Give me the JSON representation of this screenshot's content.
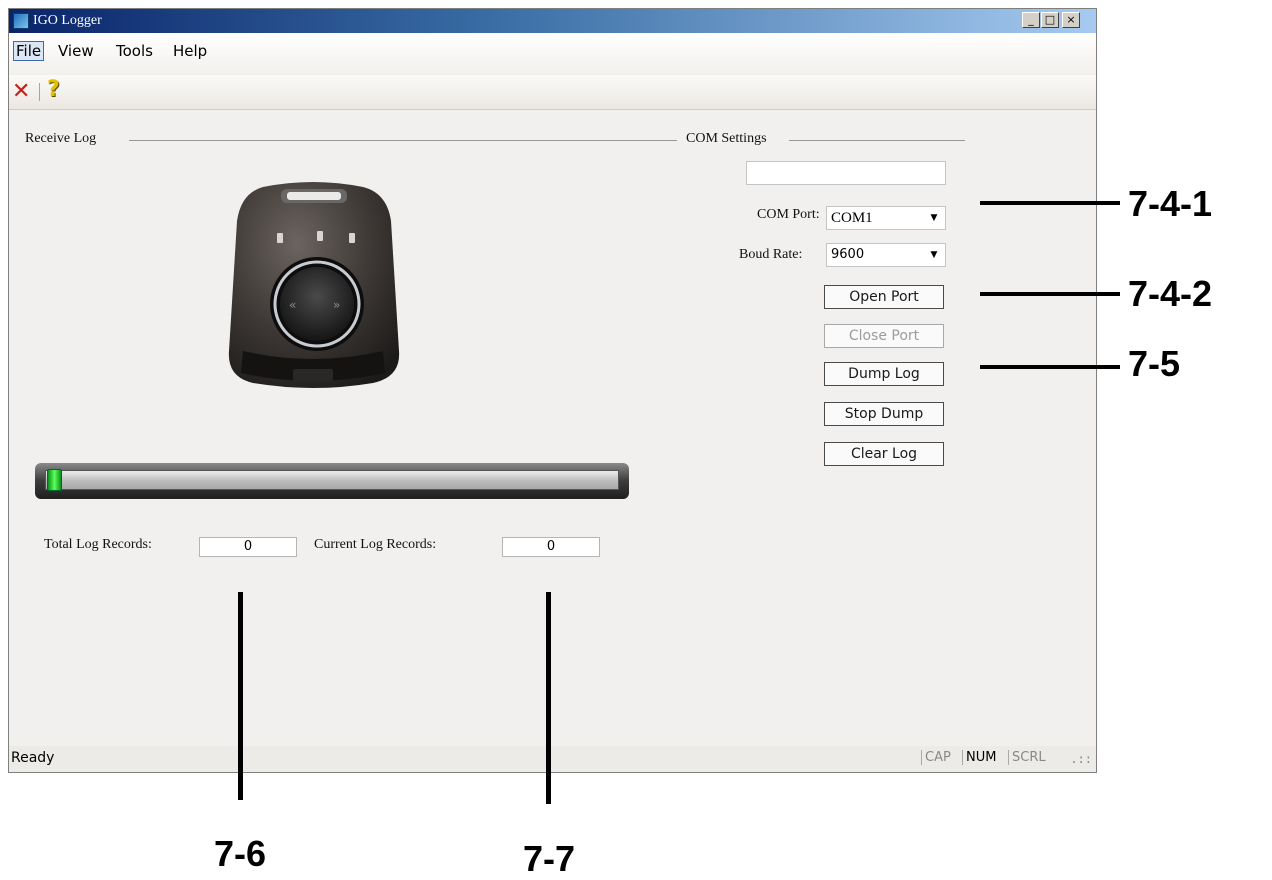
{
  "window": {
    "title": "IGO Logger",
    "controls": [
      "_",
      "□",
      "×"
    ]
  },
  "menubar": {
    "items": [
      "File",
      "View",
      "Tools",
      "Help"
    ]
  },
  "toolbar": {
    "close_icon": "close-icon",
    "help_icon": "help-icon"
  },
  "receive_log": {
    "label": "Receive Log",
    "progress_fraction": 0.0,
    "total_label": "Total Log Records:",
    "total_value": "0",
    "current_label": "Current Log Records:",
    "current_value": "0"
  },
  "com_settings": {
    "label": "COM Settings",
    "text_field_value": "",
    "com_port_label": "COM Port:",
    "com_port_value": "COM1",
    "baud_rate_label": "Boud Rate:",
    "baud_rate_value": "9600",
    "buttons": {
      "open_port": "Open Port",
      "close_port": "Close Port",
      "dump_log": "Dump Log",
      "stop_dump": "Stop Dump",
      "clear_log": "Clear Log"
    }
  },
  "statusbar": {
    "text": "Ready",
    "indicators": [
      "CAP",
      "NUM",
      "SCRL"
    ],
    "active_indicator": "NUM"
  },
  "callouts": [
    "7-4-1",
    "7-4-2",
    "7-5",
    "7-6",
    "7-7"
  ],
  "colors": {
    "title_gradient_start": "#0a246a",
    "title_gradient_end": "#a6caf0",
    "progress_thumb": "#2bd12b",
    "close_icon": "#c42018"
  }
}
